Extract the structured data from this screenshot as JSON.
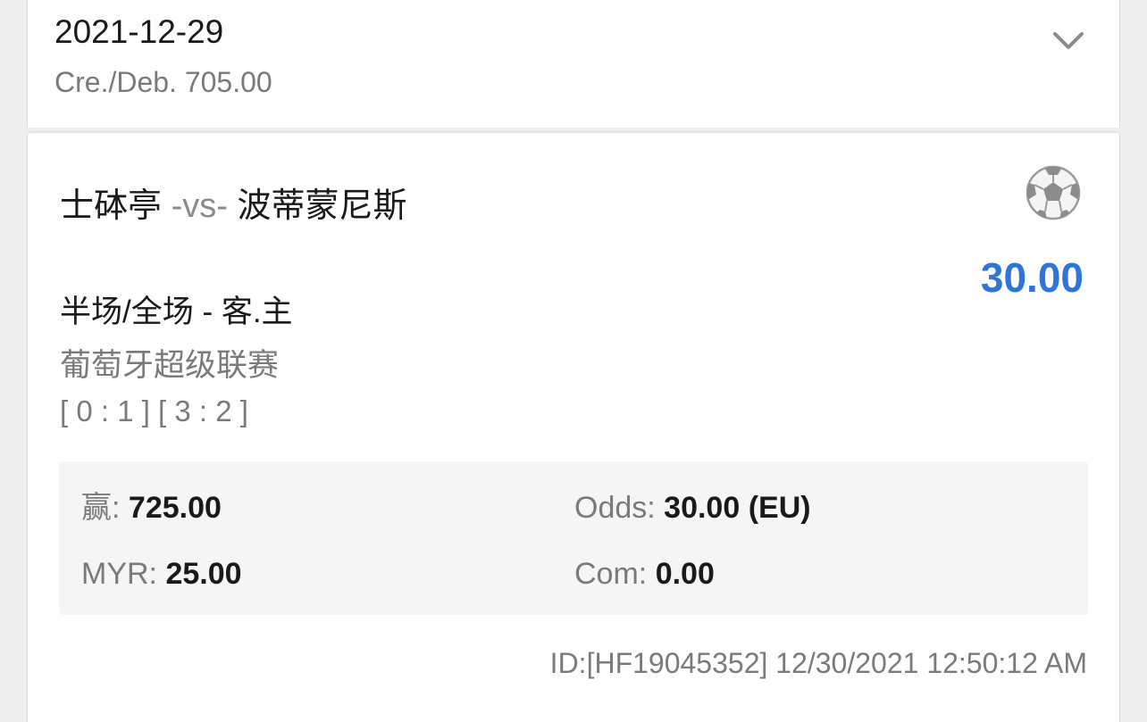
{
  "header": {
    "date": "2021-12-29",
    "credit_debit": "Cre./Deb. 705.00",
    "expand_icon": "chevron-down-icon"
  },
  "bet": {
    "home_team": "士砵亭",
    "vs_label": "-vs-",
    "away_team": "波蒂蒙尼斯",
    "sport_icon": "soccer-ball-icon",
    "stake_display": "30.00",
    "bet_type": "半场/全场 - 客.主",
    "league": "葡萄牙超级联赛",
    "scores": "[ 0 : 1 ] [ 3 : 2 ]",
    "details": {
      "win_label": "赢:",
      "win_value": "725.00",
      "odds_label": "Odds:",
      "odds_value": "30.00 (EU)",
      "currency_label": "MYR:",
      "currency_value": "25.00",
      "com_label": "Com:",
      "com_value": "0.00"
    },
    "footer": "ID:[HF19045352] 12/30/2021 12:50:12 AM"
  },
  "colors": {
    "accent": "#2f74d7",
    "text_primary": "#1a1a1a",
    "text_secondary": "#7a7a7a",
    "detail_bg": "#f5f5f5",
    "page_bg": "#eeeeee"
  }
}
